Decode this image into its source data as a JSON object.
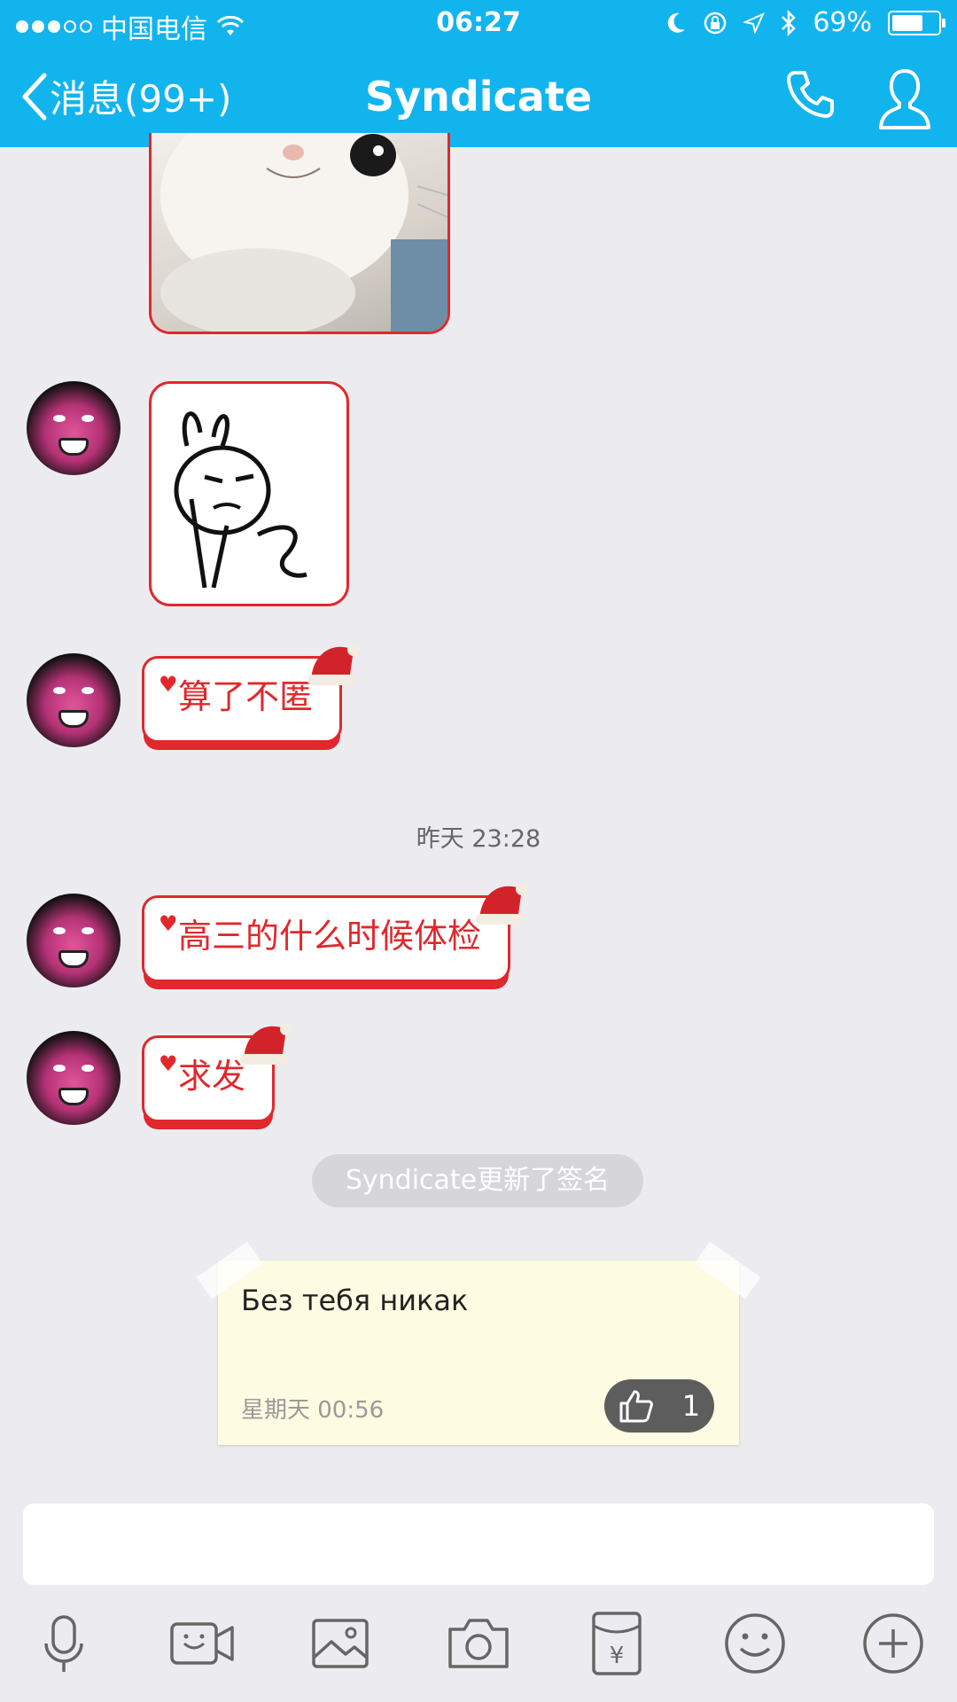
{
  "status": {
    "carrier": "中国电信",
    "time": "06:27",
    "battery": "69%"
  },
  "nav": {
    "back_label": "消息(99+)",
    "title": "Syndicate"
  },
  "messages": {
    "text1": "算了不匿",
    "timestamp": "昨天 23:28",
    "text2": "高三的什么时候体检",
    "text3": "求发"
  },
  "system_notice": "Syndicate更新了签名",
  "signature_card": {
    "text": "Без тебя никак",
    "date": "星期天 00:56",
    "likes": "1"
  },
  "input": {
    "placeholder": ""
  },
  "toolbar_icons": [
    "microphone-icon",
    "video-call-icon",
    "image-icon",
    "camera-icon",
    "red-packet-icon",
    "emoji-icon",
    "plus-icon"
  ],
  "colors": {
    "header": "#12b4ee",
    "bubble_border": "#e0282d",
    "background": "#ececf0"
  }
}
